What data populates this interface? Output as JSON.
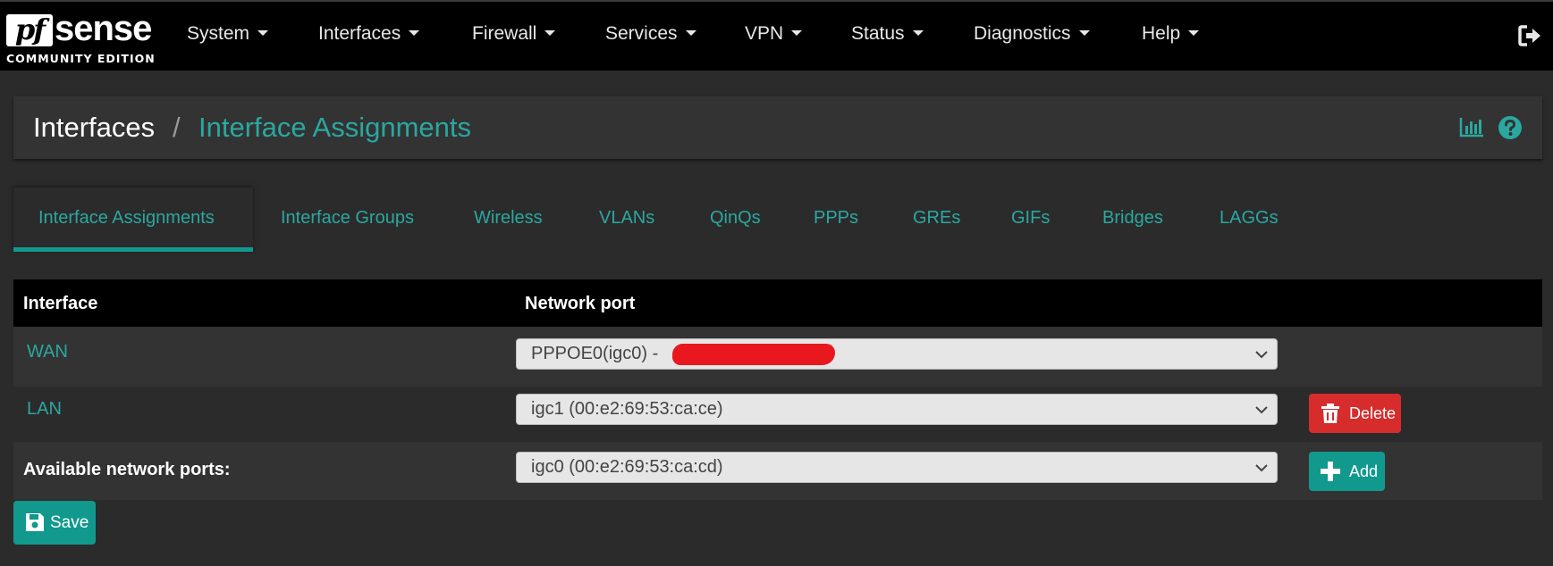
{
  "brand": {
    "pf": "pf",
    "sense": "sense",
    "edition": "COMMUNITY EDITION"
  },
  "nav": {
    "items": [
      {
        "label": "System"
      },
      {
        "label": "Interfaces"
      },
      {
        "label": "Firewall"
      },
      {
        "label": "Services"
      },
      {
        "label": "VPN"
      },
      {
        "label": "Status"
      },
      {
        "label": "Diagnostics"
      },
      {
        "label": "Help"
      }
    ],
    "logout_icon": "sign-out-icon"
  },
  "breadcrumb": {
    "root": "Interfaces",
    "separator": "/",
    "current": "Interface Assignments",
    "icons": [
      "bar-chart-icon",
      "help-circle-icon"
    ]
  },
  "tabs": [
    {
      "label": "Interface Assignments",
      "active": true
    },
    {
      "label": "Interface Groups"
    },
    {
      "label": "Wireless"
    },
    {
      "label": "VLANs"
    },
    {
      "label": "QinQs"
    },
    {
      "label": "PPPs"
    },
    {
      "label": "GREs"
    },
    {
      "label": "GIFs"
    },
    {
      "label": "Bridges"
    },
    {
      "label": "LAGGs"
    }
  ],
  "table": {
    "headers": {
      "interface": "Interface",
      "network_port": "Network port"
    },
    "rows": [
      {
        "interface": "WAN",
        "port": "PPPOE0(igc0) -"
      },
      {
        "interface": "LAN",
        "port": "igc1 (00:e2:69:53:ca:ce)",
        "action": "Delete"
      }
    ],
    "available": {
      "label": "Available network ports:",
      "port": "igc0 (00:e2:69:53:ca:cd)",
      "action": "Add"
    }
  },
  "save_label": "Save",
  "colors": {
    "accent": "#2aa8a0",
    "success": "#11998e",
    "danger": "#d62c2c",
    "navbar": "#000000",
    "background": "#2b2b2b"
  }
}
